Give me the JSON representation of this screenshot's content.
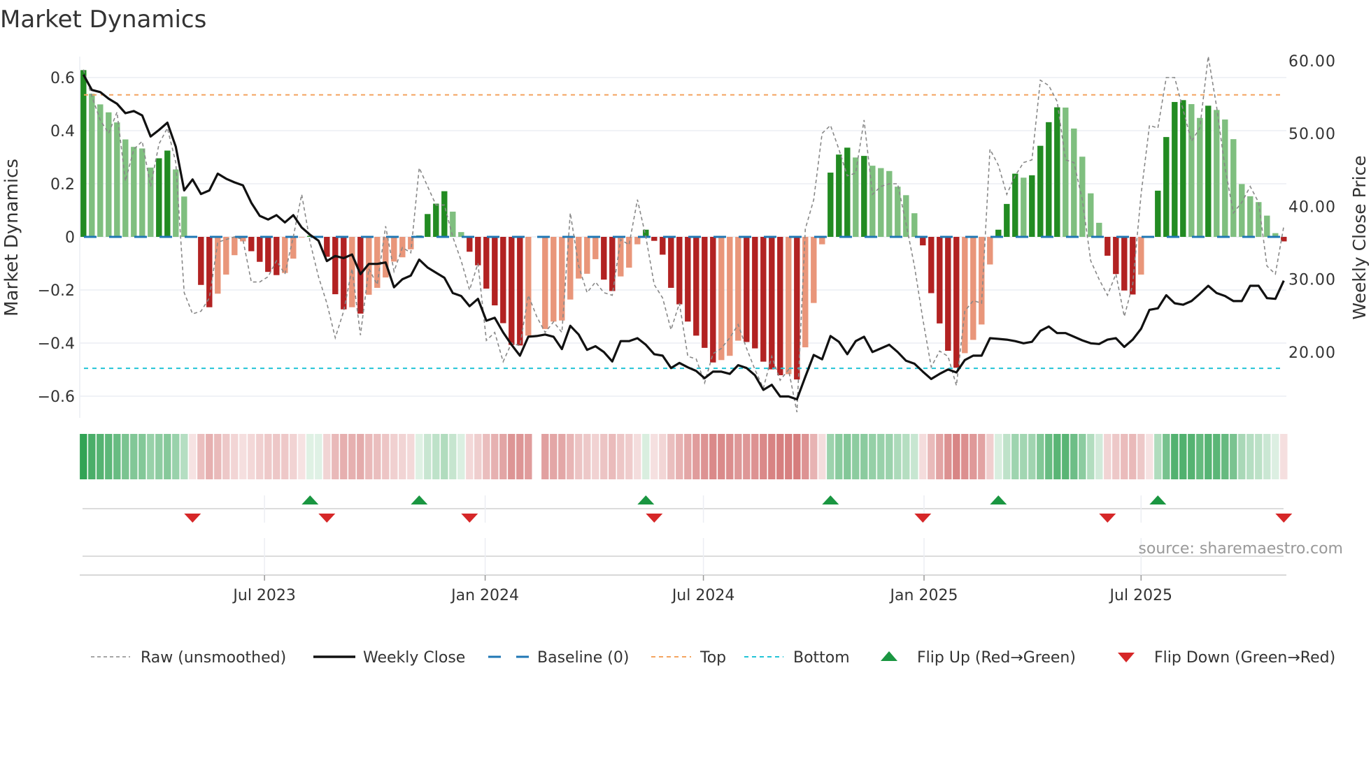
{
  "chart_data": {
    "type": "bar",
    "title": "Market Dynamics",
    "ylabel": "Market Dynamics",
    "y2label": "Weekly Close Price",
    "ylim": [
      -0.68,
      0.68
    ],
    "y2lim": [
      10.9,
      60.6
    ],
    "grid": true,
    "legend_position": "bottom",
    "start_date": "2023-01-31",
    "frequency_days": 7,
    "y_ticks": [
      {
        "value": 0.6,
        "label": "0.6"
      },
      {
        "value": 0.4,
        "label": "0.4"
      },
      {
        "value": 0.2,
        "label": "0.2"
      },
      {
        "value": 0,
        "label": "0"
      },
      {
        "value": -0.2,
        "label": "−0.2"
      },
      {
        "value": -0.4,
        "label": "−0.4"
      },
      {
        "value": -0.6,
        "label": "−0.6"
      }
    ],
    "y2_ticks": [
      {
        "value": 60,
        "label": "60.00"
      },
      {
        "value": 50,
        "label": "50.00"
      },
      {
        "value": 40,
        "label": "40.00"
      },
      {
        "value": 30,
        "label": "30.00"
      },
      {
        "value": 20,
        "label": "20.00"
      }
    ],
    "x_ticks": [
      {
        "date": "2023-07-01",
        "label": "Jul 2023"
      },
      {
        "date": "2024-01-01",
        "label": "Jan 2024"
      },
      {
        "date": "2024-07-01",
        "label": "Jul 2024"
      },
      {
        "date": "2025-01-01",
        "label": "Jan 2025"
      },
      {
        "date": "2025-07-01",
        "label": "Jul 2025"
      }
    ],
    "top_threshold": 0.535,
    "bottom_threshold": -0.495,
    "baseline": 0,
    "series": [
      {
        "name": "Market Dynamics (smoothed)",
        "type": "bar",
        "values": [
          0.628,
          0.539,
          0.499,
          0.469,
          0.431,
          0.367,
          0.339,
          0.333,
          0.261,
          0.296,
          0.325,
          0.254,
          0.152,
          -0.003,
          -0.181,
          -0.265,
          -0.214,
          -0.142,
          -0.069,
          -0.017,
          -0.054,
          -0.094,
          -0.132,
          -0.144,
          -0.136,
          -0.082,
          -0.002,
          0.004,
          0.003,
          -0.075,
          -0.216,
          -0.273,
          -0.265,
          -0.289,
          -0.218,
          -0.192,
          -0.153,
          -0.093,
          -0.077,
          -0.047,
          0.005,
          0.086,
          0.125,
          0.172,
          0.095,
          0.018,
          -0.056,
          -0.107,
          -0.195,
          -0.258,
          -0.325,
          -0.407,
          -0.409,
          -0.372,
          null,
          -0.347,
          -0.319,
          -0.315,
          -0.236,
          -0.157,
          -0.139,
          -0.084,
          -0.161,
          -0.204,
          -0.149,
          -0.116,
          -0.028,
          0.027,
          -0.015,
          -0.067,
          -0.192,
          -0.254,
          -0.319,
          -0.372,
          -0.418,
          -0.473,
          -0.464,
          -0.448,
          -0.391,
          -0.396,
          -0.42,
          -0.47,
          -0.499,
          -0.521,
          -0.517,
          -0.537,
          -0.416,
          -0.249,
          -0.028,
          0.242,
          0.31,
          0.336,
          0.299,
          0.305,
          0.268,
          0.259,
          0.248,
          0.189,
          0.157,
          0.089,
          -0.032,
          -0.212,
          -0.326,
          -0.429,
          -0.493,
          -0.438,
          -0.388,
          -0.33,
          -0.104,
          0.027,
          0.124,
          0.238,
          0.223,
          0.232,
          0.343,
          0.432,
          0.488,
          0.487,
          0.408,
          0.302,
          0.164,
          0.053,
          -0.071,
          -0.14,
          -0.202,
          -0.217,
          -0.142,
          -0.003,
          0.174,
          0.376,
          0.508,
          0.515,
          0.5,
          0.448,
          0.494,
          0.478,
          0.442,
          0.368,
          0.199,
          0.153,
          0.131,
          0.08,
          0.014,
          -0.017
        ]
      },
      {
        "name": "Raw (unsmoothed)",
        "type": "line",
        "values": [
          0.63,
          0.53,
          0.44,
          0.39,
          0.47,
          0.21,
          0.33,
          0.36,
          0.19,
          0.35,
          0.41,
          0.28,
          -0.21,
          -0.29,
          -0.28,
          -0.23,
          -0.02,
          -0.01,
          0.0,
          -0.01,
          -0.17,
          -0.17,
          -0.15,
          -0.09,
          -0.14,
          0.0,
          0.16,
          -0.02,
          -0.15,
          -0.25,
          -0.38,
          -0.28,
          -0.12,
          -0.37,
          -0.12,
          -0.18,
          0.04,
          -0.13,
          -0.04,
          -0.06,
          0.26,
          0.19,
          0.12,
          0.12,
          0.0,
          -0.09,
          -0.2,
          -0.1,
          -0.39,
          -0.36,
          -0.47,
          -0.4,
          -0.41,
          -0.22,
          -0.3,
          -0.36,
          -0.32,
          -0.36,
          0.09,
          -0.11,
          -0.21,
          -0.17,
          -0.21,
          -0.22,
          -0.01,
          -0.03,
          0.14,
          0.0,
          -0.18,
          -0.23,
          -0.35,
          -0.25,
          -0.45,
          -0.46,
          -0.55,
          -0.44,
          -0.42,
          -0.38,
          -0.33,
          -0.42,
          -0.5,
          -0.57,
          -0.45,
          -0.54,
          -0.5,
          -0.66,
          0.03,
          0.14,
          0.39,
          0.42,
          0.33,
          0.23,
          0.24,
          0.44,
          0.16,
          0.19,
          0.2,
          0.2,
          0.05,
          -0.11,
          -0.31,
          -0.49,
          -0.43,
          -0.45,
          -0.56,
          -0.28,
          -0.24,
          -0.25,
          0.33,
          0.27,
          0.16,
          0.23,
          0.28,
          0.29,
          0.59,
          0.57,
          0.51,
          0.29,
          0.28,
          0.14,
          -0.09,
          -0.16,
          -0.22,
          -0.14,
          -0.3,
          -0.18,
          0.16,
          0.42,
          0.41,
          0.6,
          0.6,
          0.48,
          0.36,
          0.41,
          0.68,
          0.49,
          0.26,
          0.09,
          0.13,
          0.19,
          0.13,
          -0.11,
          -0.14,
          0.04
        ]
      },
      {
        "name": "Weekly Close",
        "type": "line",
        "axis": "y2",
        "values": [
          58.1,
          56.0,
          55.7,
          54.8,
          54.1,
          52.8,
          53.1,
          52.5,
          49.6,
          50.5,
          51.5,
          48.2,
          42.2,
          43.7,
          41.7,
          42.2,
          44.5,
          43.8,
          43.3,
          42.9,
          40.5,
          38.7,
          38.2,
          38.8,
          37.8,
          38.8,
          37.1,
          36.1,
          35.3,
          32.5,
          33.2,
          32.9,
          33.4,
          30.7,
          32.1,
          32.1,
          32.3,
          28.9,
          30.0,
          30.5,
          32.7,
          31.6,
          30.9,
          30.2,
          28.1,
          27.7,
          26.3,
          27.3,
          24.3,
          24.7,
          22.7,
          21.0,
          19.5,
          22.1,
          22.2,
          22.4,
          22.1,
          20.4,
          23.6,
          22.4,
          20.3,
          20.8,
          20.0,
          18.7,
          21.5,
          21.5,
          21.9,
          21.0,
          19.7,
          19.5,
          17.8,
          18.5,
          17.9,
          17.4,
          16.4,
          17.3,
          17.3,
          17.0,
          18.2,
          17.8,
          16.8,
          14.8,
          15.5,
          13.9,
          13.9,
          13.5,
          16.6,
          19.6,
          19.0,
          22.2,
          21.4,
          19.7,
          21.5,
          22.1,
          20.0,
          20.5,
          21.0,
          20.0,
          18.8,
          18.4,
          17.3,
          16.3,
          17.0,
          17.6,
          17.2,
          18.9,
          19.5,
          19.5,
          21.9,
          21.8,
          21.7,
          21.5,
          21.2,
          21.4,
          22.9,
          23.5,
          22.6,
          22.6,
          22.1,
          21.6,
          21.2,
          21.1,
          21.7,
          21.9,
          20.7,
          21.7,
          23.2,
          25.8,
          26.0,
          27.8,
          26.7,
          26.5,
          27.0,
          28.0,
          29.1,
          28.1,
          27.7,
          27.0,
          27.0,
          29.1,
          29.1,
          27.4,
          27.3,
          29.8
        ]
      }
    ],
    "colors": {
      "up_strong": "#228b22",
      "up_weak": "#7fbf7f",
      "down_strong": "#b22222",
      "down_weak": "#e9967a",
      "raw": "#888888",
      "close": "#111111",
      "baseline": "#1f77b4",
      "top": "#f4a460",
      "bottom": "#22c4d6",
      "flip_up": "#1a9641",
      "flip_down": "#d62728",
      "grid": "#eceef3"
    },
    "legend": [
      {
        "key": "raw",
        "label": "Raw (unsmoothed)"
      },
      {
        "key": "close",
        "label": "Weekly Close"
      },
      {
        "key": "baseline",
        "label": "Baseline (0)"
      },
      {
        "key": "top",
        "label": "Top"
      },
      {
        "key": "bottom",
        "label": "Bottom"
      },
      {
        "key": "flip_up",
        "label": "Flip Up (Red→Green)"
      },
      {
        "key": "flip_down",
        "label": "Flip Down (Green→Red)"
      }
    ],
    "source": "source: sharemaestro.com"
  }
}
